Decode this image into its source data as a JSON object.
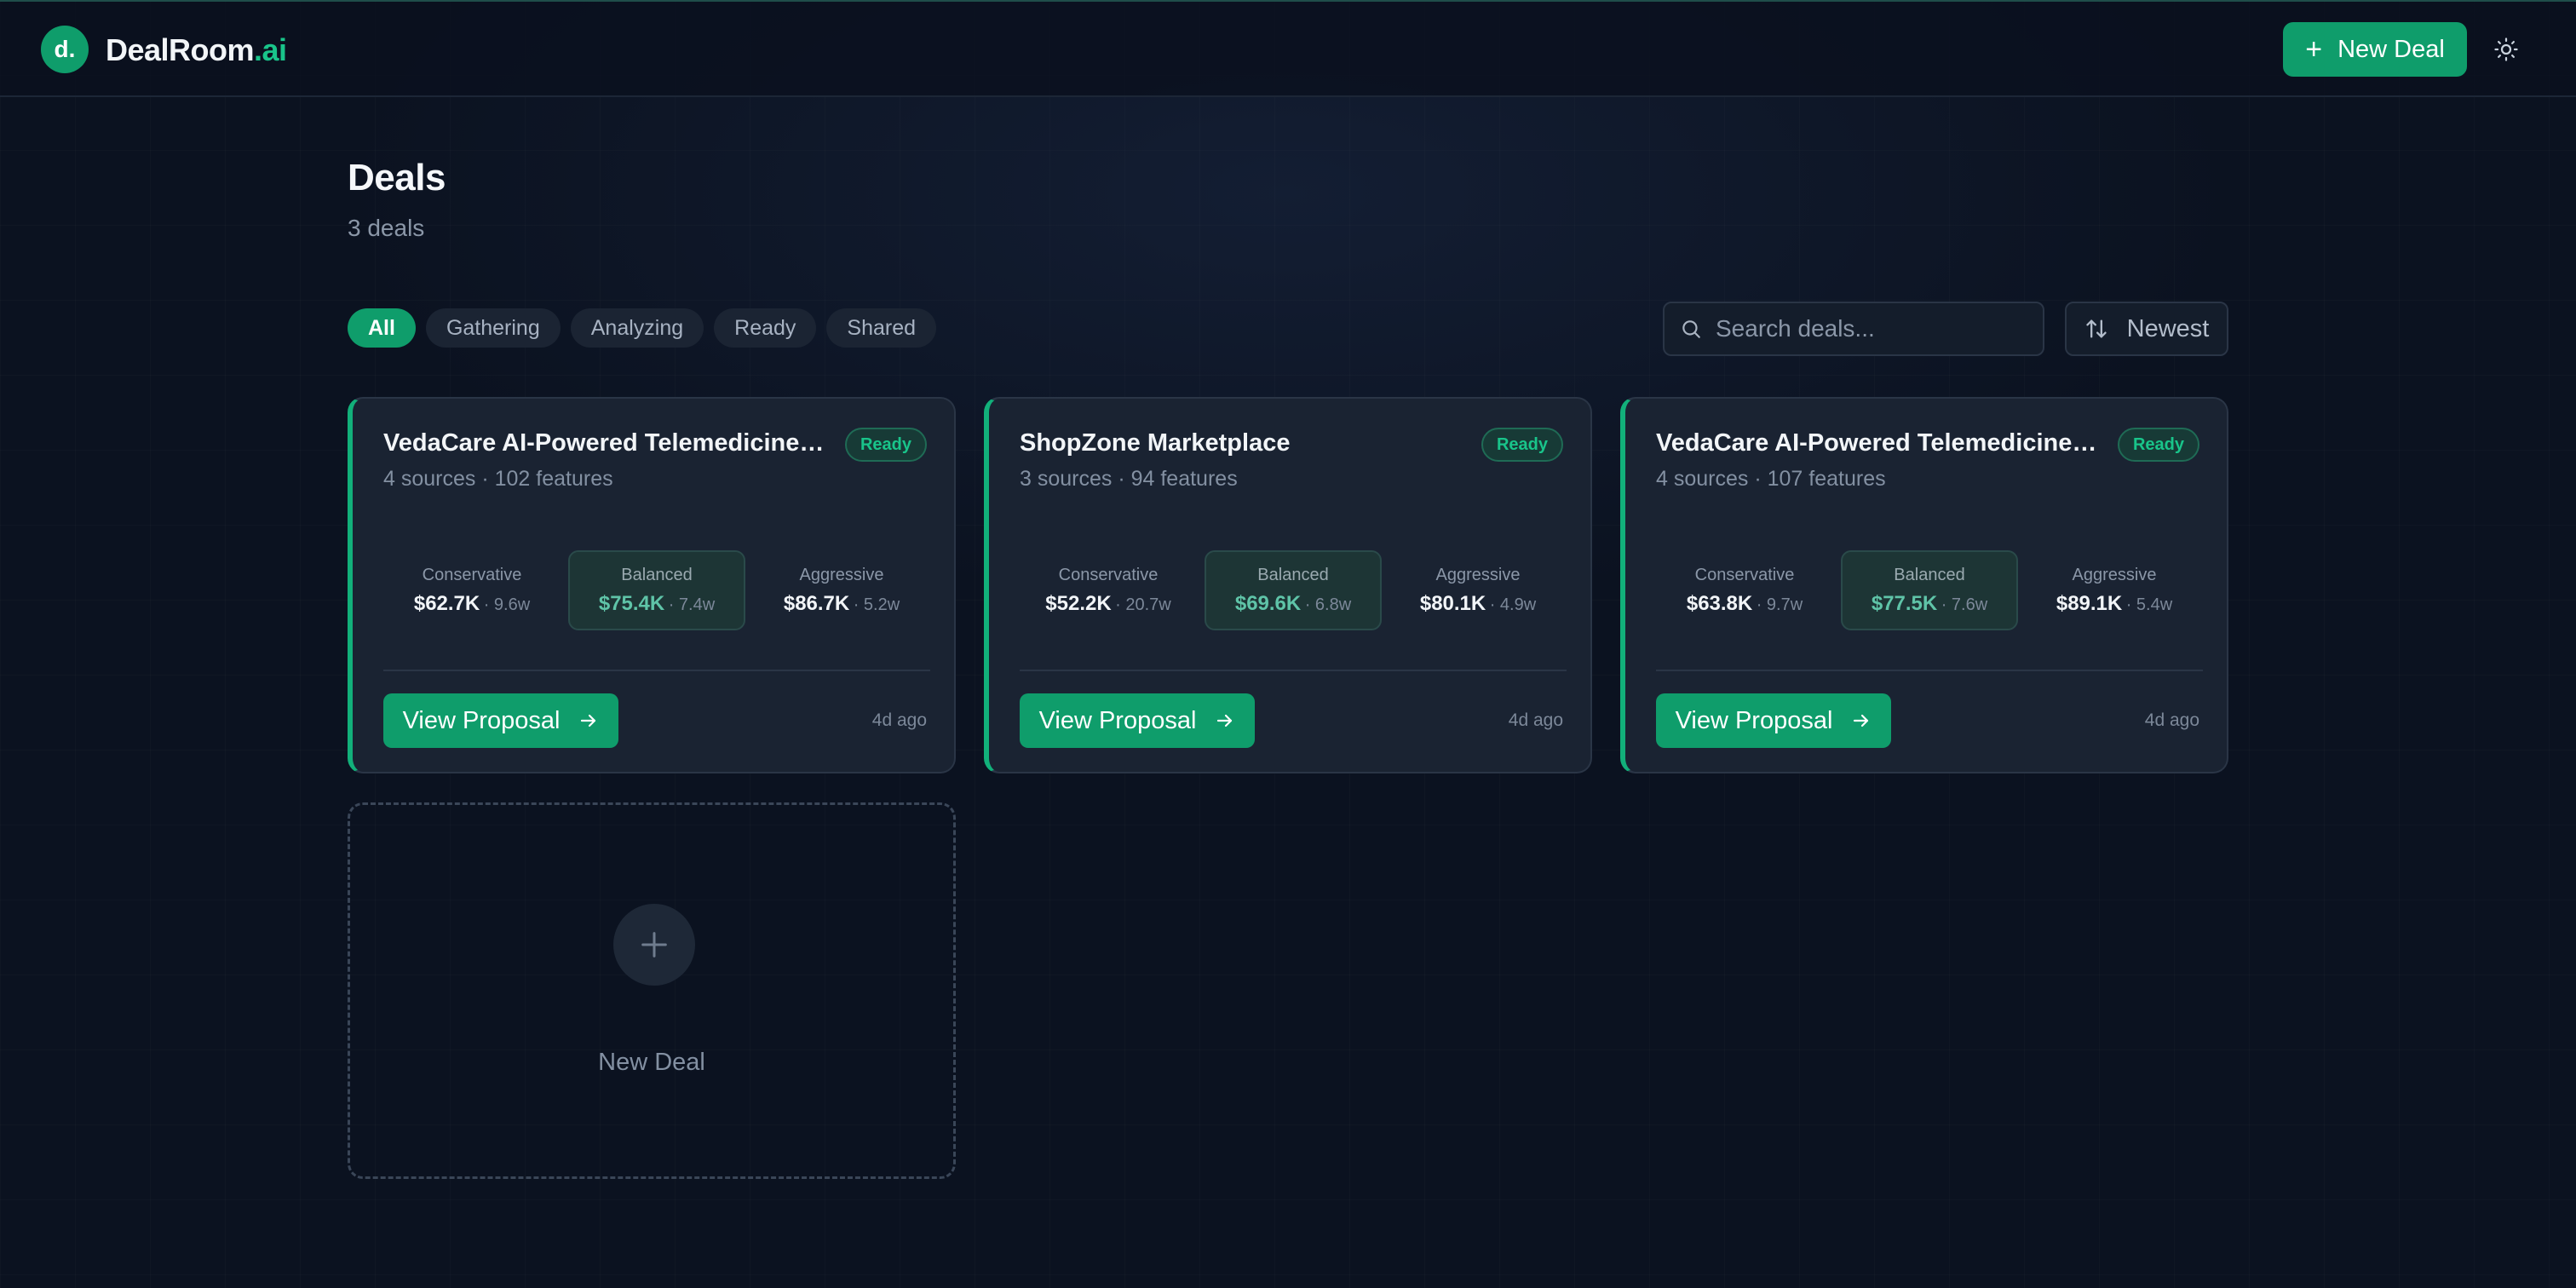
{
  "app": {
    "logo_mark": "d.",
    "name_main": "DealRoom",
    "name_accent": ".ai",
    "new_deal_label": "New Deal",
    "theme_icon": "sun-icon"
  },
  "page": {
    "title": "Deals",
    "subtitle": "3 deals"
  },
  "filters": [
    "All",
    "Gathering",
    "Analyzing",
    "Ready",
    "Shared"
  ],
  "active_filter": "All",
  "search": {
    "placeholder": "Search deals..."
  },
  "sort": {
    "label": "Newest"
  },
  "colors": {
    "accent": "#0f9d6b",
    "badge_text": "#19c48a"
  },
  "deals": [
    {
      "title": "VedaCare AI-Powered Telemedicine ...",
      "status": "Ready",
      "meta": "4 sources · 102 features",
      "tiers": [
        {
          "label": "Conservative",
          "value": "$62.7K",
          "weeks": "· 9.6w"
        },
        {
          "label": "Balanced",
          "value": "$75.4K",
          "weeks": "· 7.4w"
        },
        {
          "label": "Aggressive",
          "value": "$86.7K",
          "weeks": "· 5.2w"
        }
      ],
      "action": "View Proposal",
      "time": "4d ago"
    },
    {
      "title": "ShopZone Marketplace",
      "status": "Ready",
      "meta": "3 sources · 94 features",
      "tiers": [
        {
          "label": "Conservative",
          "value": "$52.2K",
          "weeks": "· 20.7w"
        },
        {
          "label": "Balanced",
          "value": "$69.6K",
          "weeks": "· 6.8w"
        },
        {
          "label": "Aggressive",
          "value": "$80.1K",
          "weeks": "· 4.9w"
        }
      ],
      "action": "View Proposal",
      "time": "4d ago"
    },
    {
      "title": "VedaCare AI-Powered Telemedicine ...",
      "status": "Ready",
      "meta": "4 sources · 107 features",
      "tiers": [
        {
          "label": "Conservative",
          "value": "$63.8K",
          "weeks": "· 9.7w"
        },
        {
          "label": "Balanced",
          "value": "$77.5K",
          "weeks": "· 7.6w"
        },
        {
          "label": "Aggressive",
          "value": "$89.1K",
          "weeks": "· 5.4w"
        }
      ],
      "action": "View Proposal",
      "time": "4d ago"
    }
  ],
  "new_deal_card": {
    "label": "New Deal"
  }
}
